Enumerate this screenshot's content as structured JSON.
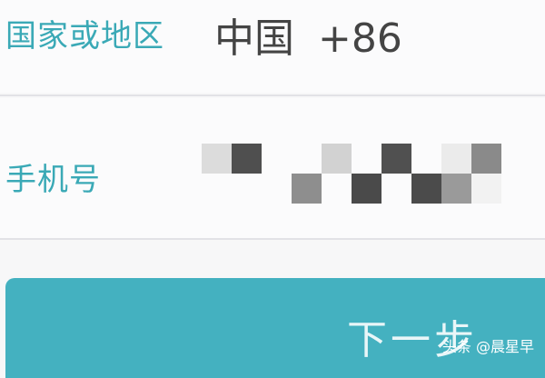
{
  "form": {
    "country_label": "国家或地区",
    "country_name": "中国",
    "country_code": "+86",
    "phone_label": "手机号",
    "phone_value_obscured": true
  },
  "actions": {
    "next_label": "下一步"
  },
  "watermark": {
    "text": "头条 @晨星早"
  },
  "colors": {
    "accent": "#3aa9b6",
    "button": "#44b1c0",
    "background": "#f7f7f8"
  }
}
